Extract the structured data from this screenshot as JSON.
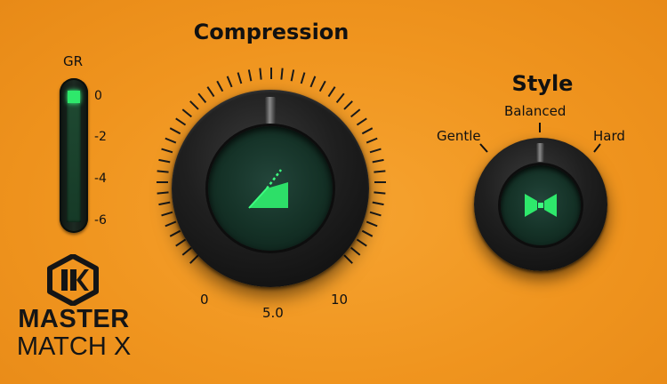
{
  "gain_reduction": {
    "label": "GR",
    "scale": [
      "0",
      "-2",
      "-4",
      "-6"
    ],
    "meter_level_db": 0,
    "led_color": "#2ee86b"
  },
  "compression": {
    "title": "Compression",
    "scale_labels": {
      "min": "0",
      "mid": "5.0",
      "max": "10"
    },
    "knob_value": 5.0,
    "display_icon": "compression-curve-icon"
  },
  "style": {
    "title": "Style",
    "options": [
      "Gentle",
      "Balanced",
      "Hard"
    ],
    "selected": "Balanced",
    "display_icon": "bowtie-icon"
  },
  "brand": {
    "logo_icon": "ik-logo-icon",
    "line1": "MASTER",
    "line2": "MATCH X"
  },
  "colors": {
    "background": "#f0951f",
    "display_green": "#2ee86b",
    "knob": "#1a1a1a"
  }
}
